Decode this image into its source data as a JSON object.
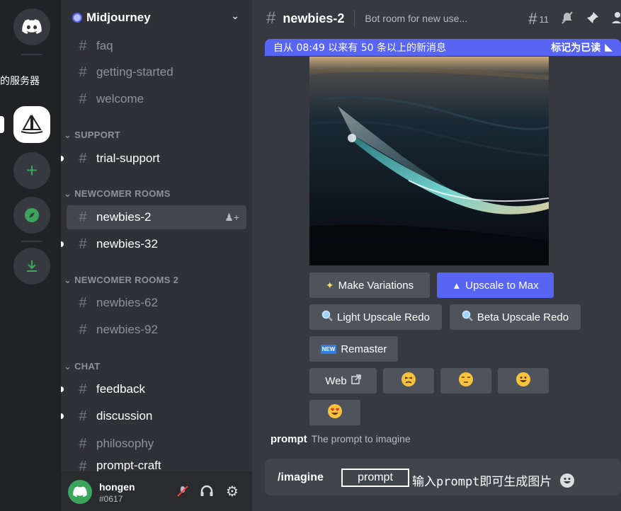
{
  "rail": {
    "partial_label": "的服务器"
  },
  "guild": {
    "name": "Midjourney"
  },
  "channels": {
    "top": [
      {
        "label": "faq"
      },
      {
        "label": "getting-started"
      },
      {
        "label": "welcome"
      }
    ],
    "support_cat": "SUPPORT",
    "support": [
      {
        "label": "trial-support"
      }
    ],
    "newcomer_cat": "NEWCOMER ROOMS",
    "newcomer": [
      {
        "label": "newbies-2"
      },
      {
        "label": "newbies-32"
      }
    ],
    "newcomer2_cat": "NEWCOMER ROOMS 2",
    "newcomer2": [
      {
        "label": "newbies-62"
      },
      {
        "label": "newbies-92"
      }
    ],
    "chat_cat": "CHAT",
    "chat": [
      {
        "label": "feedback"
      },
      {
        "label": "discussion"
      },
      {
        "label": "philosophy"
      },
      {
        "label": "prompt-craft"
      }
    ]
  },
  "user": {
    "name": "hongen",
    "tag": "#0617"
  },
  "header": {
    "channel": "newbies-2",
    "topic": "Bot room for new use...",
    "thread_count": "11"
  },
  "banner": {
    "text": "自从 08:49 以来有 50 条以上的新消息",
    "mark_read": "标记为已读"
  },
  "buttons": {
    "make_variations": "Make Variations",
    "upscale_max": "Upscale to Max",
    "light_redo": "Light Upscale Redo",
    "beta_redo": "Beta Upscale Redo",
    "remaster": "Remaster",
    "new_badge": "NEW",
    "web": "Web"
  },
  "composer": {
    "hint_cmd": "prompt",
    "hint_desc": "The prompt to imagine",
    "command": "/imagine",
    "param": "prompt",
    "caption": "输入prompt即可生成图片"
  }
}
